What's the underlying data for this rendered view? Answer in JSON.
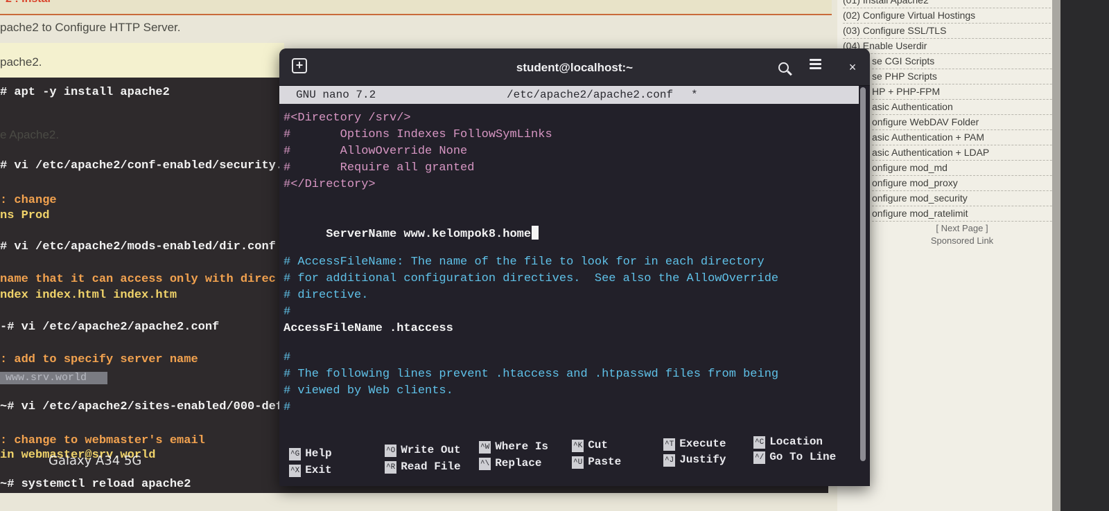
{
  "background_page": {
    "top_heading": "2 : Instal",
    "lines": [
      "pache2 to Configure HTTP Server.",
      "pache2.",
      "e Apache2."
    ],
    "code_lines": [
      "# apt -y install apache2",
      "# vi /etc/apache2/conf-enabled/security.",
      ": change",
      "ns Prod",
      "# vi /etc/apache2/mods-enabled/dir.conf",
      " name that it can access only with direc",
      "ndex index.html index.htm",
      "-# vi /etc/apache2/apache2.conf",
      " : add to specify server name",
      "~# vi /etc/apache2/sites-enabled/000-defa",
      " : change to webmaster's email",
      "in webmaster@srv.world",
      "~# systemctl reload apache2"
    ],
    "highlight_text": "www.srv.world",
    "watermark": "Galaxy A34 5G"
  },
  "sidebar": {
    "items": [
      "(01) Install Apache2",
      "(02) Configure Virtual Hostings",
      "(03) Configure SSL/TLS",
      "(04) Enable Userdir",
      "se CGI Scripts",
      "se PHP Scripts",
      "HP + PHP-FPM",
      "asic Authentication",
      "onfigure WebDAV Folder",
      "asic Authentication + PAM",
      "asic Authentication + LDAP",
      "onfigure mod_md",
      "onfigure mod_proxy",
      "onfigure mod_security",
      "onfigure mod_ratelimit"
    ],
    "next_page": "[ Next Page ]",
    "sponsored": "Sponsored Link"
  },
  "terminal": {
    "title": "student@localhost:~",
    "icons": {
      "new_tab": "new-tab-icon",
      "search": "search-icon",
      "menu": "hamburger-menu-icon",
      "close": "close-icon"
    },
    "close_glyph": "×",
    "new_tab_glyph": "+",
    "nano": {
      "version": "GNU nano 7.2",
      "filename": "/etc/apache2/apache2.conf",
      "modified": "*"
    },
    "lines": [
      "#<Directory /srv/>",
      "#       Options Indexes FollowSymLinks",
      "#       AllowOverride None",
      "#       Require all granted",
      "#</Directory>",
      "ServerName www.kelompok8.home",
      "# AccessFileName: The name of the file to look for in each directory",
      "# for additional configuration directives.  See also the AllowOverride",
      "# directive.",
      "#",
      "AccessFileName .htaccess",
      "#",
      "# The following lines prevent .htaccess and .htpasswd files from being",
      "# viewed by Web clients.",
      "#"
    ],
    "shortcuts": [
      {
        "key": "^G",
        "label": "Help"
      },
      {
        "key": "^X",
        "label": "Exit"
      },
      {
        "key": "^O",
        "label": "Write Out"
      },
      {
        "key": "^R",
        "label": "Read File"
      },
      {
        "key": "^W",
        "label": "Where Is"
      },
      {
        "key": "^\\",
        "label": "Replace"
      },
      {
        "key": "^K",
        "label": "Cut"
      },
      {
        "key": "^U",
        "label": "Paste"
      },
      {
        "key": "^T",
        "label": "Execute"
      },
      {
        "key": "^J",
        "label": "Justify"
      },
      {
        "key": "^C",
        "label": "Location"
      },
      {
        "key": "^/",
        "label": "Go To Line"
      }
    ]
  },
  "colors": {
    "terminal_bg": "#222029",
    "comment_pink": "#d796c3",
    "comment_cyan": "#5fc1e8",
    "code_yellow": "#f2c95a"
  }
}
